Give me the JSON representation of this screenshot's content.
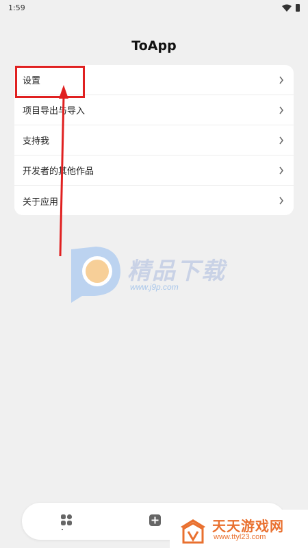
{
  "status_bar": {
    "time": "1:59",
    "wifi_icon": "wifi-icon",
    "battery_icon": "battery-icon"
  },
  "header": {
    "title": "ToApp"
  },
  "menu": {
    "items": [
      {
        "label": "设置",
        "icon": "chevron-right-icon"
      },
      {
        "label": "项目导出与导入",
        "icon": "chevron-right-icon"
      },
      {
        "label": "支持我",
        "icon": "chevron-right-icon"
      },
      {
        "label": "开发者的其他作品",
        "icon": "chevron-right-icon"
      },
      {
        "label": "关于应用",
        "icon": "chevron-right-icon"
      }
    ]
  },
  "annotation": {
    "highlight_color": "#e02020",
    "target": "设置"
  },
  "watermark": {
    "title": "精品下载",
    "url": "www.j9p.com"
  },
  "bottom_nav": {
    "items": [
      {
        "icon": "apps-grid-icon"
      },
      {
        "icon": "add-square-icon"
      }
    ]
  },
  "corner_watermark": {
    "title": "天天游戏网",
    "url": "www.ttyl23.com",
    "color": "#e9702f"
  }
}
